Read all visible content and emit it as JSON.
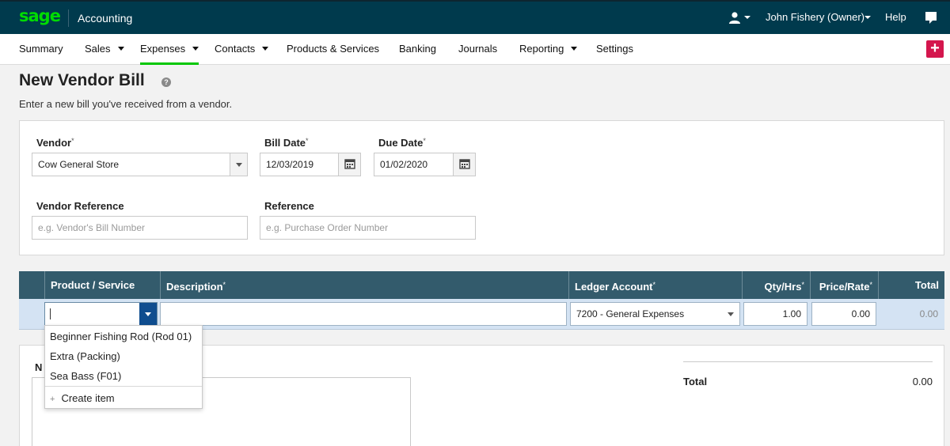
{
  "header": {
    "logo": "sage",
    "app_name": "Accounting",
    "user_name": "John Fishery (Owner)",
    "help": "Help"
  },
  "nav": {
    "items": [
      {
        "label": "Summary",
        "has_caret": false,
        "active": false
      },
      {
        "label": "Sales",
        "has_caret": true,
        "active": false
      },
      {
        "label": "Expenses",
        "has_caret": true,
        "active": true
      },
      {
        "label": "Contacts",
        "has_caret": true,
        "active": false
      },
      {
        "label": "Products & Services",
        "has_caret": false,
        "active": false
      },
      {
        "label": "Banking",
        "has_caret": false,
        "active": false
      },
      {
        "label": "Journals",
        "has_caret": false,
        "active": false
      },
      {
        "label": "Reporting",
        "has_caret": true,
        "active": false
      },
      {
        "label": "Settings",
        "has_caret": false,
        "active": false
      }
    ],
    "plus": "+"
  },
  "page": {
    "title": "New Vendor Bill",
    "help_icon": "?",
    "subtitle": "Enter a new bill you've received from a vendor."
  },
  "form": {
    "vendor": {
      "label": "Vendor",
      "value": "Cow General Store"
    },
    "bill_date": {
      "label": "Bill Date",
      "value": "12/03/2019"
    },
    "due_date": {
      "label": "Due Date",
      "value": "01/02/2020"
    },
    "vendor_reference": {
      "label": "Vendor Reference",
      "placeholder": "e.g. Vendor's Bill Number"
    },
    "reference": {
      "label": "Reference",
      "placeholder": "e.g. Purchase Order Number"
    },
    "required_mark": "*"
  },
  "table": {
    "columns": {
      "product": "Product / Service",
      "description": "Description",
      "ledger": "Ledger Account",
      "qty": "Qty/Hrs",
      "price": "Price/Rate",
      "total": "Total"
    },
    "row": {
      "product": "",
      "description": "",
      "ledger": "7200 - General Expenses",
      "qty": "1.00",
      "price": "0.00",
      "total": "0.00"
    }
  },
  "dropdown": {
    "items": [
      "Beginner Fishing Rod (Rod 01)",
      "Extra (Packing)",
      "Sea Bass (F01)"
    ],
    "create": "Create item"
  },
  "footer": {
    "notes_label": "N",
    "total_label": "Total",
    "total_value": "0.00"
  },
  "colors": {
    "topbar": "#003a4d",
    "brand_green": "#00dc00",
    "active_tab": "#00c700",
    "plus_button": "#d4164d",
    "table_header": "#335b6c",
    "row_highlight": "#d4e3f3",
    "dropdown_button": "#0f4d8f"
  }
}
